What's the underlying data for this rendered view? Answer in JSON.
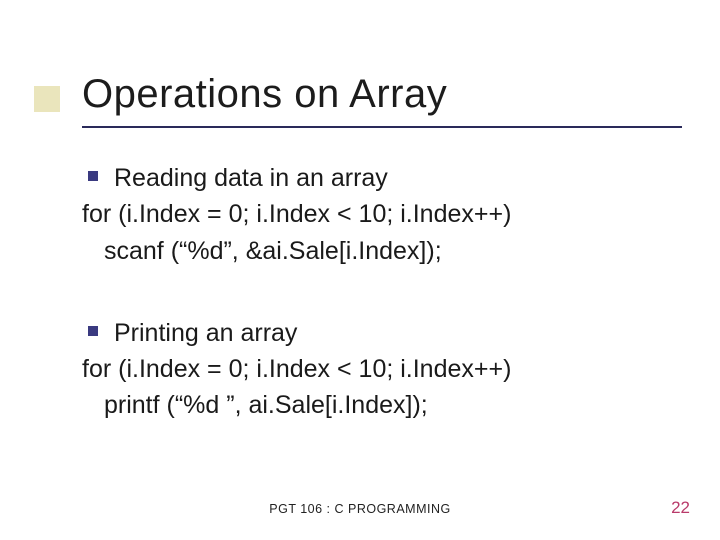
{
  "title": "Operations on Array",
  "section1": {
    "heading": "Reading data in an array",
    "code_line1": "for (i.Index = 0; i.Index < 10; i.Index++)",
    "code_line2": "scanf (“%d”, &ai.Sale[i.Index]);"
  },
  "section2": {
    "heading": "Printing an array",
    "code_line1": "for (i.Index = 0; i.Index < 10; i.Index++)",
    "code_line2": "printf (“%d ”, ai.Sale[i.Index]);"
  },
  "footer": "PGT 106 : C PROGRAMMING",
  "page_number": "22"
}
